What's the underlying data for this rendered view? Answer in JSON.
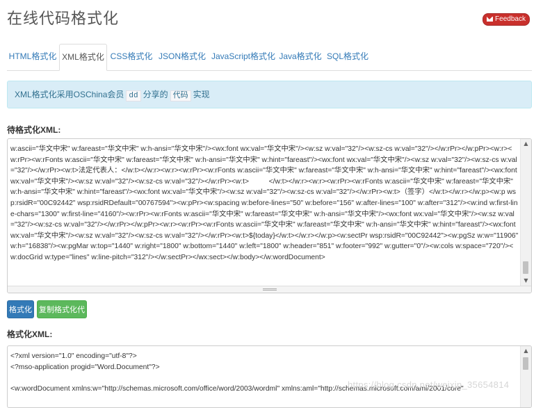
{
  "header": {
    "title": "在线代码格式化",
    "feedback_label": "Feedback"
  },
  "tabs": [
    {
      "label": "HTML格式化"
    },
    {
      "label": "XML格式化"
    },
    {
      "label": "CSS格式化"
    },
    {
      "label": "JSON格式化"
    },
    {
      "label": "JavaScript格式化"
    },
    {
      "label": "Java格式化"
    },
    {
      "label": "SQL格式化"
    }
  ],
  "active_tab": "XML格式化",
  "info": {
    "prefix": "XML格式化采用OSChina会员",
    "member": "dd",
    "middle": "分享的",
    "code_link": "代码",
    "suffix": "实现"
  },
  "input": {
    "label": "待格式化XML:",
    "value": "w:ascii=\"华文中宋\" w:fareast=\"华文中宋\" w:h-ansi=\"华文中宋\"/><wx:font wx:val=\"华文中宋\"/><w:sz w:val=\"32\"/><w:sz-cs w:val=\"32\"/></w:rPr></w:pPr><w:r><w:rPr><w:rFonts w:ascii=\"华文中宋\" w:fareast=\"华文中宋\" w:h-ansi=\"华文中宋\" w:hint=\"fareast\"/><wx:font wx:val=\"华文中宋\"/><w:sz w:val=\"32\"/><w:sz-cs w:val=\"32\"/></w:rPr><w:t>法定代表人：</w:t></w:r><w:r><w:rPr><w:rFonts w:ascii=\"华文中宋\" w:fareast=\"华文中宋\" w:h-ansi=\"华文中宋\" w:hint=\"fareast\"/><wx:font wx:val=\"华文中宋\"/><w:sz w:val=\"32\"/><w:sz-cs w:val=\"32\"/></w:rPr><w:t>          </w:t></w:r><w:r><w:rPr><w:rFonts w:ascii=\"华文中宋\" w:fareast=\"华文中宋\" w:h-ansi=\"华文中宋\" w:hint=\"fareast\"/><wx:font wx:val=\"华文中宋\"/><w:sz w:val=\"32\"/><w:sz-cs w:val=\"32\"/></w:rPr><w:t>（签字）</w:t></w:r></w:p><w:p wsp:rsidR=\"00C92442\" wsp:rsidRDefault=\"00767594\"><w:pPr><w:spacing w:before-lines=\"50\" w:before=\"156\" w:after-lines=\"100\" w:after=\"312\"/><w:ind w:first-line-chars=\"1300\" w:first-line=\"4160\"/><w:rPr><w:rFonts w:ascii=\"华文中宋\" w:fareast=\"华文中宋\" w:h-ansi=\"华文中宋\"/><wx:font wx:val=\"华文中宋\"/><w:sz w:val=\"32\"/><w:sz-cs w:val=\"32\"/></w:rPr></w:pPr><w:r><w:rPr><w:rFonts w:ascii=\"华文中宋\" w:fareast=\"华文中宋\" w:h-ansi=\"华文中宋\" w:hint=\"fareast\"/><wx:font wx:val=\"华文中宋\"/><w:sz w:val=\"32\"/><w:sz-cs w:val=\"32\"/></w:rPr><w:t>${today}</w:t></w:r></w:p><w:sectPr wsp:rsidR=\"00C92442\"><w:pgSz w:w=\"11906\" w:h=\"16838\"/><w:pgMar w:top=\"1440\" w:right=\"1800\" w:bottom=\"1440\" w:left=\"1800\" w:header=\"851\" w:footer=\"992\" w:gutter=\"0\"/><w:cols w:space=\"720\"/><w:docGrid w:type=\"lines\" w:line-pitch=\"312\"/></w:sectPr></wx:sect></w:body></w:wordDocument>"
  },
  "buttons": {
    "format": "格式化",
    "copy": "复制格式化代码"
  },
  "output": {
    "label": "格式化XML:",
    "value": "<?xml version=\"1.0\" encoding=\"utf-8\"?>\n<?mso-application progid=\"Word.Document\"?>\n\n<w:wordDocument xmlns:w=\"http://schemas.microsoft.com/office/word/2003/wordml\" xmlns:aml=\"http://schemas.microsoft.com/aml/2001/core\""
  },
  "watermark": "https://blog.csdn.net/weixin_35654814",
  "colors": {
    "link": "#337ab7",
    "feedback_bg": "#c9302c",
    "info_bg": "#d9edf7",
    "primary": "#337ab7",
    "success": "#5cb85c"
  }
}
